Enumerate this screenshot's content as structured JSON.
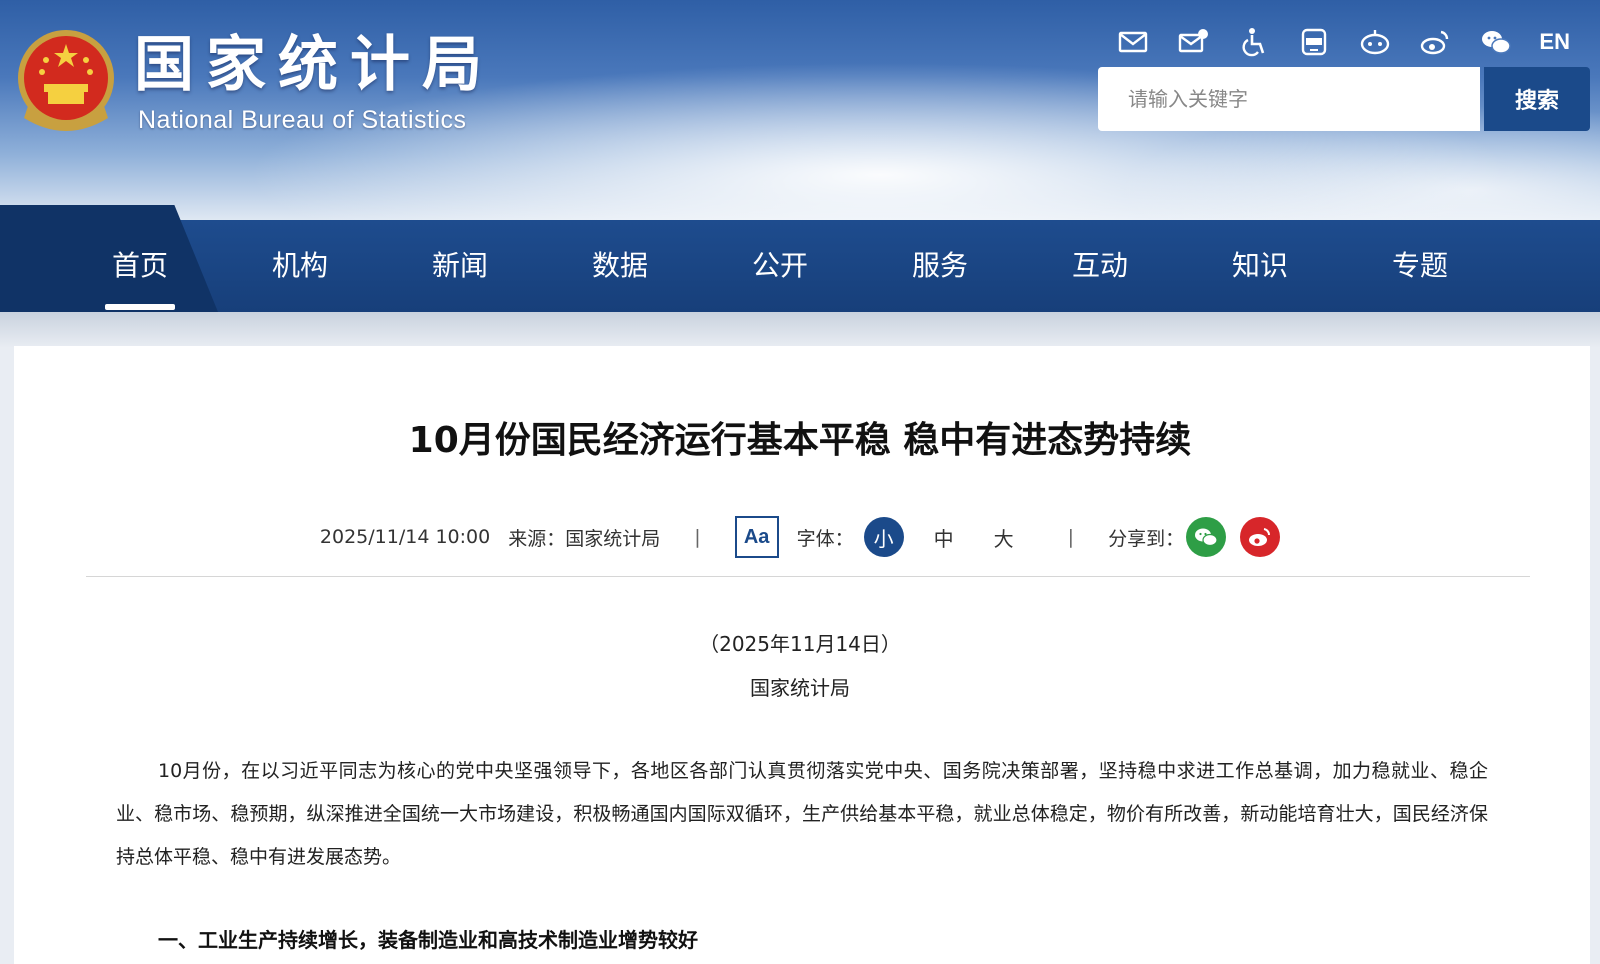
{
  "header": {
    "site_name": "国家统计局",
    "site_name_en": "National Bureau of Statistics",
    "toolbar": [
      "mail-icon",
      "letter-icon",
      "accessibility-icon",
      "app-icon",
      "robot-icon",
      "weibo-icon",
      "wechat-icon"
    ],
    "lang_label": "EN",
    "search": {
      "placeholder": "请输入关键字",
      "value": "",
      "button_label": "搜索"
    },
    "colors": {
      "brand": "#1b4a8a",
      "nav": "#1e4c8e"
    }
  },
  "nav": {
    "items": [
      {
        "label": "首页",
        "active": true
      },
      {
        "label": "机构"
      },
      {
        "label": "新闻"
      },
      {
        "label": "数据"
      },
      {
        "label": "公开"
      },
      {
        "label": "服务"
      },
      {
        "label": "互动"
      },
      {
        "label": "知识"
      },
      {
        "label": "专题"
      }
    ]
  },
  "article": {
    "title": "10月份国民经济运行基本平稳 稳中有进态势持续",
    "date": "2025/11/14 10:00",
    "source": "来源：国家统计局",
    "meta_sep": "|",
    "font_icon_label": "Aa",
    "font_label": "字体：",
    "font_sizes": [
      "小",
      "中",
      "大"
    ],
    "share_label": "分享到：",
    "dateline": "（2025年11月14日）",
    "byline": "国家统计局",
    "paragraph": "10月份，在以习近平同志为核心的党中央坚强领导下，各地区各部门认真贯彻落实党中央、国务院决策部署，坚持稳中求进工作总基调，加力稳就业、稳企业、稳市场、稳预期，纵深推进全国统一大市场建设，积极畅通国内国际双循环，生产供给基本平稳，就业总体稳定，物价有所改善，新动能培育壮大，国民经济保持总体平稳、稳中有进发展态势。",
    "section_heading": "一、工业生产持续增长，装备制造业和高技术制造业增势较好"
  }
}
